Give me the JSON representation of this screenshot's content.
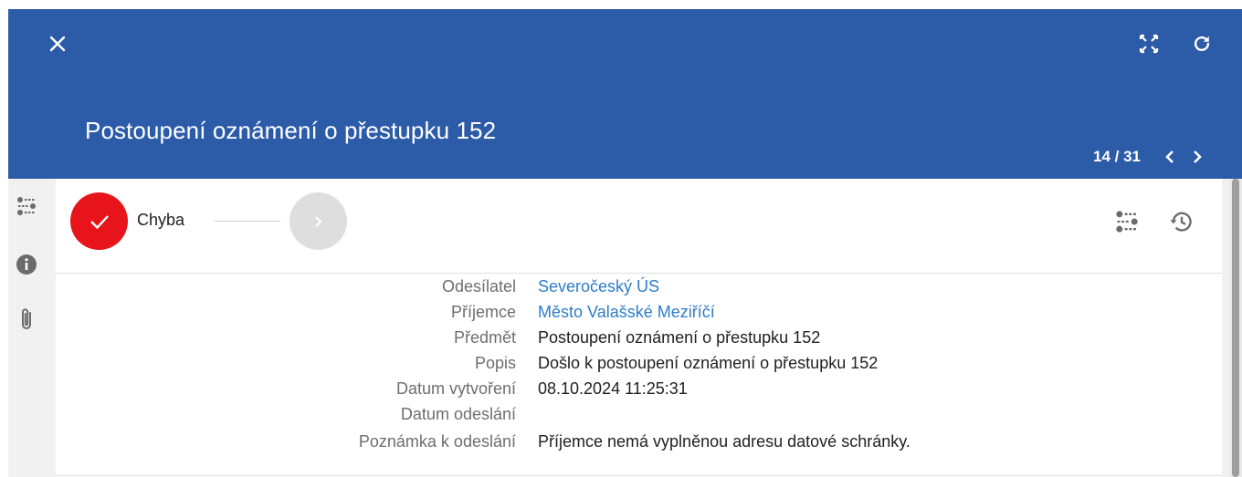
{
  "header": {
    "title": "Postoupení oznámení o přestupku 152",
    "pager": {
      "count": "14 / 31"
    },
    "background_color": "#2c5ba8"
  },
  "toolbar": {
    "close_icon": "close-icon",
    "fullscreen_icon": "fullscreen-icon",
    "refresh_icon": "refresh-icon"
  },
  "sidebar": {
    "items": [
      {
        "icon": "filter-sliders-icon"
      },
      {
        "icon": "info-icon"
      },
      {
        "icon": "paperclip-icon"
      }
    ]
  },
  "workflow": {
    "current_step_label": "Chyba",
    "current_step_color": "#e8141c",
    "tools": [
      {
        "icon": "filter-sliders-icon"
      },
      {
        "icon": "history-icon"
      }
    ]
  },
  "details": {
    "rows": [
      {
        "label": "Odesílatel",
        "value": "Severočeský ÚS",
        "link": true
      },
      {
        "label": "Příjemce",
        "value": "Město Valašské Meziříčí",
        "link": true
      },
      {
        "label": "Předmět",
        "value": "Postoupení oznámení o přestupku 152",
        "link": false
      },
      {
        "label": "Popis",
        "value": "Došlo k postoupení oznámení o přestupku 152",
        "link": false
      },
      {
        "label": "Datum vytvoření",
        "value": "08.10.2024 11:25:31",
        "link": false
      },
      {
        "label": "Datum odeslání",
        "value": "",
        "link": false
      },
      {
        "label": "Poznámka k odeslání",
        "value": "Příjemce nemá vyplněnou adresu datové schránky.",
        "link": false
      }
    ],
    "link_color": "#2e7cc9"
  }
}
